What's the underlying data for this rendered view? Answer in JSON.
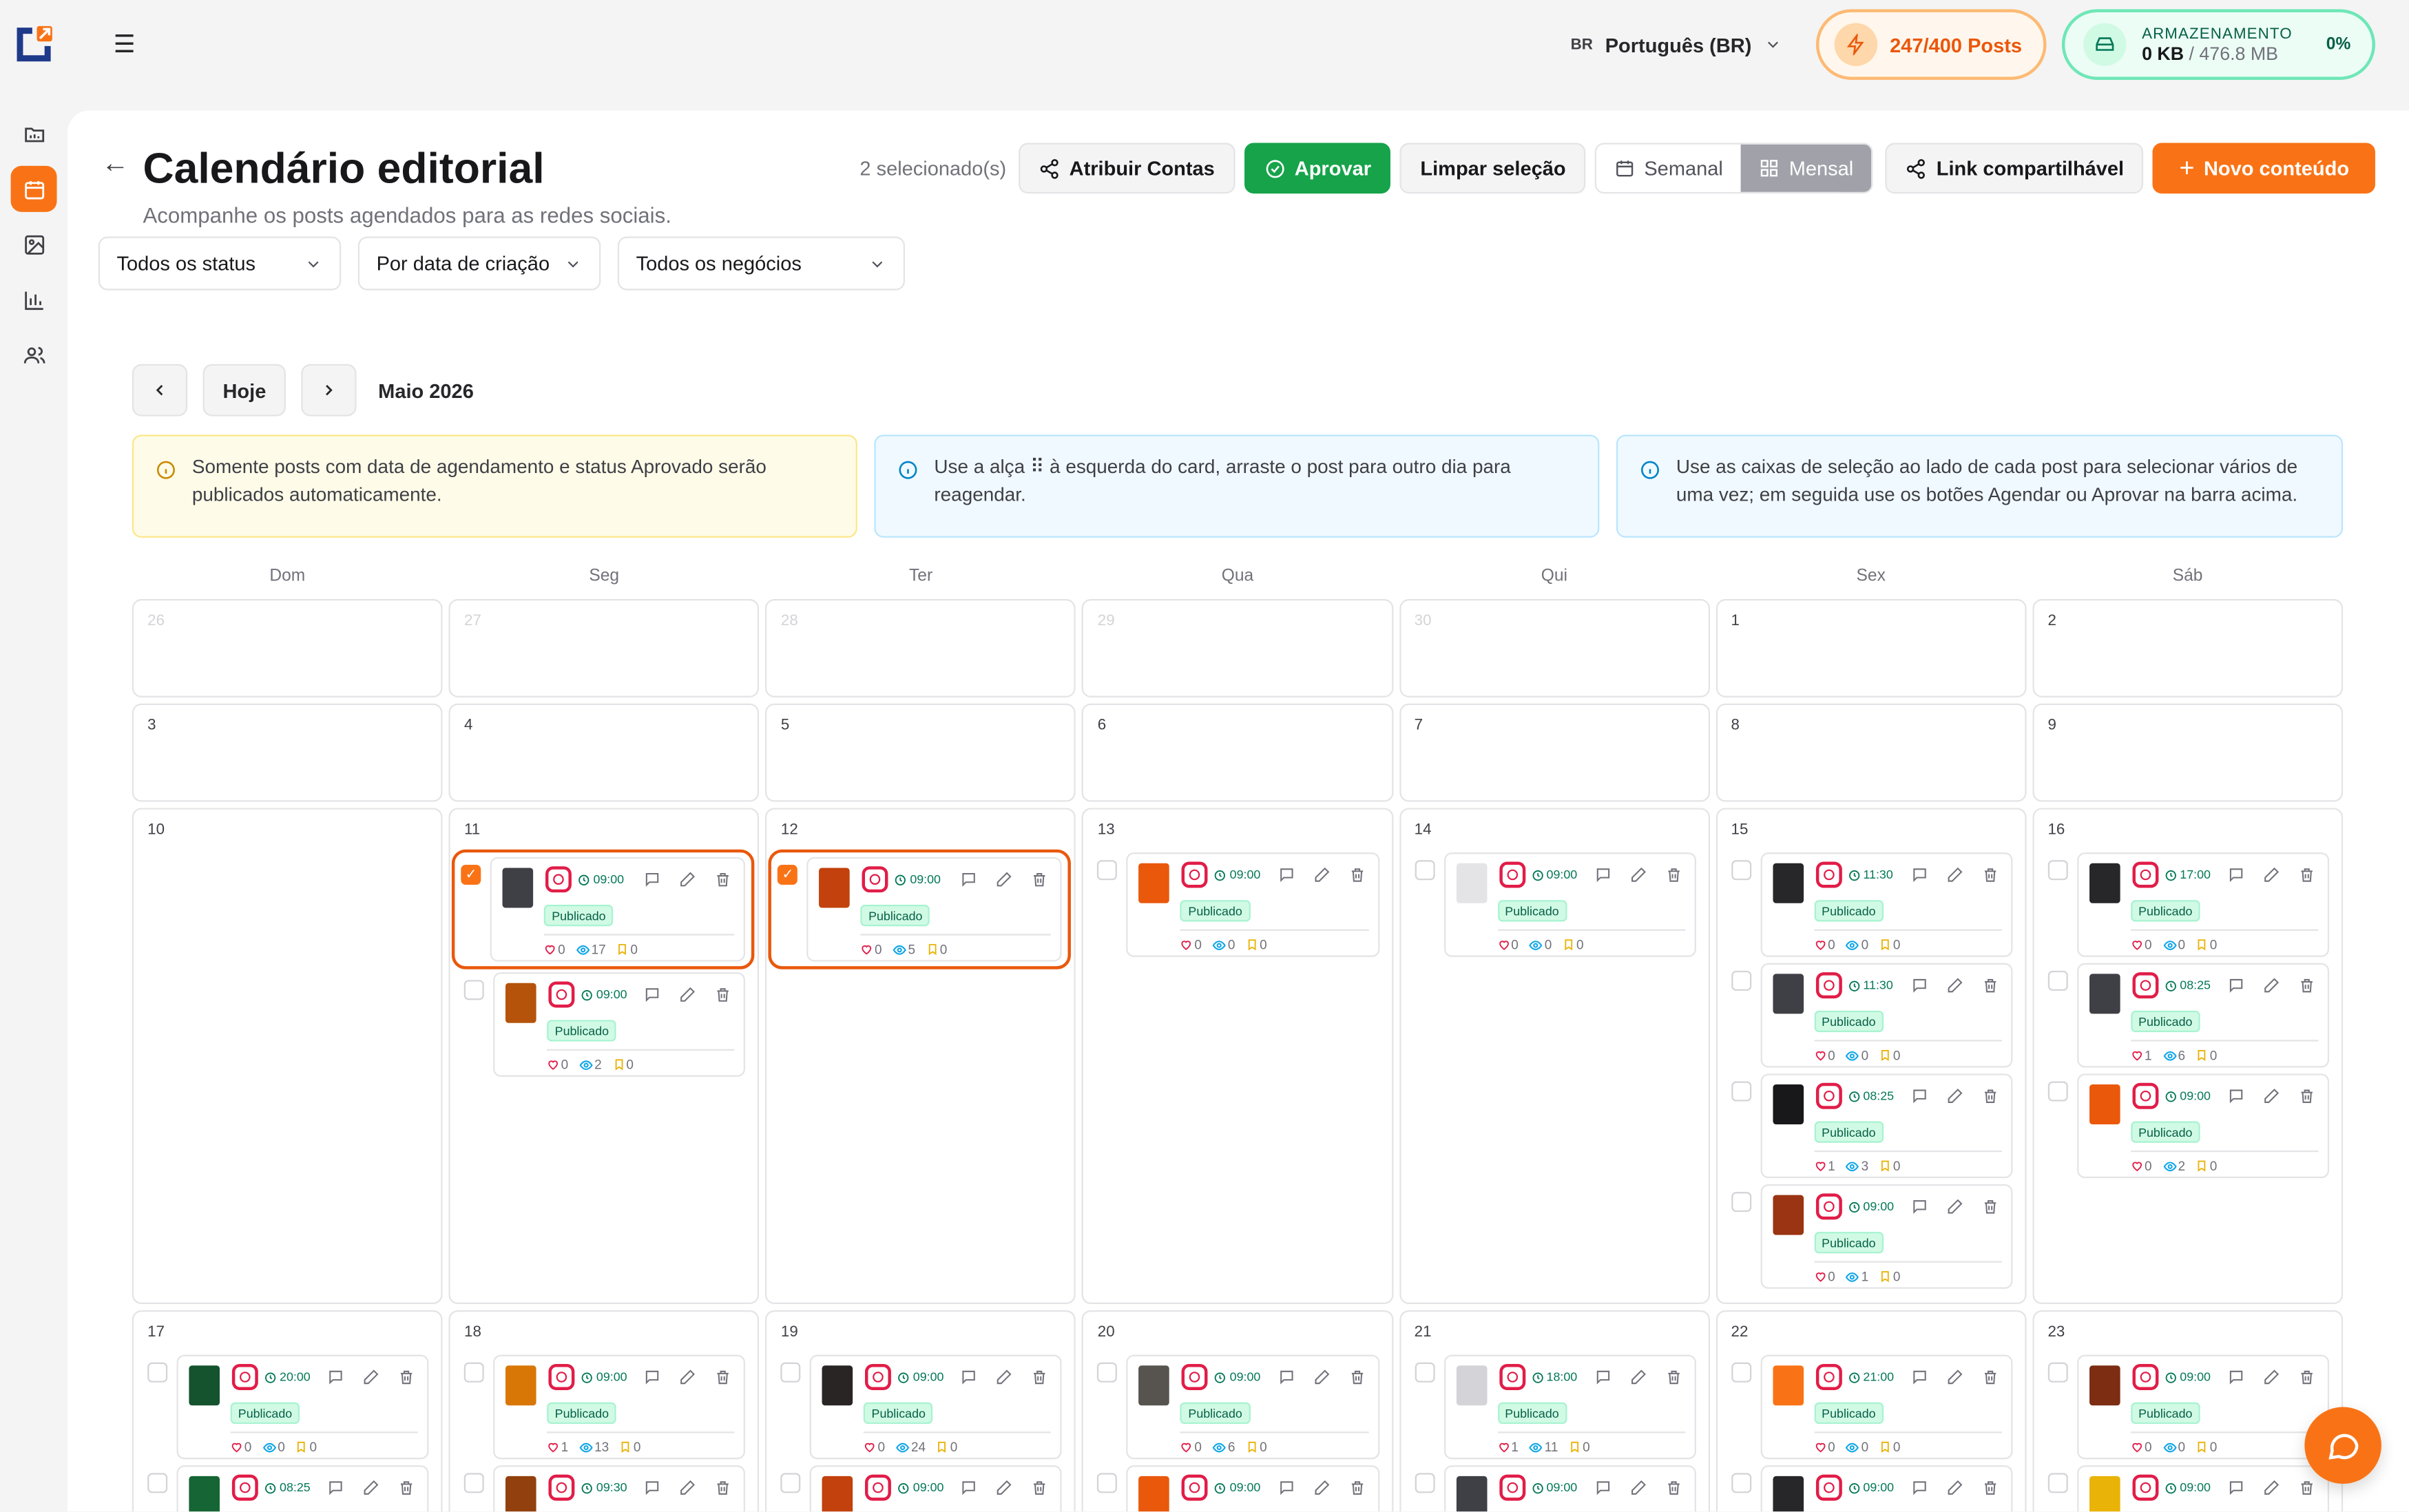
{
  "header": {
    "language_code": "BR",
    "language": "Português (BR)",
    "posts_usage": "247/400 Posts",
    "storage_label": "ARMAZENAMENTO",
    "storage_used": "0 KB",
    "storage_total": "/ 476.8 MB",
    "storage_percent": "0%"
  },
  "page": {
    "title": "Calendário editorial",
    "subtitle": "Acompanhe os posts agendados para as redes sociais.",
    "selected_count": "2 selecionado(s)",
    "assign_label": "Atribuir Contas",
    "approve_label": "Aprovar",
    "clear_label": "Limpar seleção",
    "weekly_label": "Semanal",
    "monthly_label": "Mensal",
    "share_label": "Link compartilhável",
    "new_label": "Novo conteúdo"
  },
  "filters": {
    "status": "Todos os status",
    "date": "Por data de criação",
    "business": "Todos os negócios"
  },
  "nav": {
    "today_label": "Hoje",
    "month": "Maio 2026"
  },
  "banners": {
    "warning": "Somente posts com data de agendamento e status Aprovado serão publicados automaticamente.",
    "drag": "Use a alça ⠿ à esquerda do card, arraste o post para outro dia para reagendar.",
    "select": "Use as caixas de seleção ao lado de cada post para selecionar vários de uma vez; em seguida use os botões Agendar ou Aprovar na barra acima."
  },
  "calendar": {
    "days_of_week": [
      "Dom",
      "Seg",
      "Ter",
      "Qua",
      "Qui",
      "Sex",
      "Sáb"
    ],
    "status_label": "Publicado",
    "weeks": [
      [
        {
          "day": "26",
          "out": true,
          "posts": []
        },
        {
          "day": "27",
          "out": true,
          "posts": []
        },
        {
          "day": "28",
          "out": true,
          "posts": []
        },
        {
          "day": "29",
          "out": true,
          "posts": []
        },
        {
          "day": "30",
          "out": true,
          "posts": []
        },
        {
          "day": "1",
          "out": false,
          "posts": []
        },
        {
          "day": "2",
          "out": false,
          "posts": []
        }
      ],
      [
        {
          "day": "3",
          "out": false,
          "posts": []
        },
        {
          "day": "4",
          "out": false,
          "posts": []
        },
        {
          "day": "5",
          "out": false,
          "posts": []
        },
        {
          "day": "6",
          "out": false,
          "posts": []
        },
        {
          "day": "7",
          "out": false,
          "posts": []
        },
        {
          "day": "8",
          "out": false,
          "posts": []
        },
        {
          "day": "9",
          "out": false,
          "posts": []
        }
      ],
      [
        {
          "day": "10",
          "out": false,
          "posts": []
        },
        {
          "day": "11",
          "out": false,
          "posts": [
            {
              "time": "09:00",
              "likes": "0",
              "views": "17",
              "saves": "0",
              "selected": true,
              "thumb": "#3f3f46"
            },
            {
              "time": "09:00",
              "likes": "0",
              "views": "2",
              "saves": "0",
              "selected": false,
              "thumb": "#b45309"
            }
          ]
        },
        {
          "day": "12",
          "out": false,
          "posts": [
            {
              "time": "09:00",
              "likes": "0",
              "views": "5",
              "saves": "0",
              "selected": true,
              "thumb": "#c2410c"
            }
          ]
        },
        {
          "day": "13",
          "out": false,
          "posts": [
            {
              "time": "09:00",
              "likes": "0",
              "views": "0",
              "saves": "0",
              "selected": false,
              "thumb": "#ea580c"
            }
          ]
        },
        {
          "day": "14",
          "out": false,
          "posts": [
            {
              "time": "09:00",
              "likes": "0",
              "views": "0",
              "saves": "0",
              "selected": false,
              "thumb": "#e4e4e7"
            }
          ]
        },
        {
          "day": "15",
          "out": false,
          "posts": [
            {
              "time": "11:30",
              "likes": "0",
              "views": "0",
              "saves": "0",
              "selected": false,
              "thumb": "#27272a"
            },
            {
              "time": "11:30",
              "likes": "0",
              "views": "0",
              "saves": "0",
              "selected": false,
              "thumb": "#3f3f46"
            },
            {
              "time": "08:25",
              "likes": "1",
              "views": "3",
              "saves": "0",
              "selected": false,
              "thumb": "#18181b"
            },
            {
              "time": "09:00",
              "likes": "0",
              "views": "1",
              "saves": "0",
              "selected": false,
              "thumb": "#9a3412"
            }
          ]
        },
        {
          "day": "16",
          "out": false,
          "posts": [
            {
              "time": "17:00",
              "likes": "0",
              "views": "0",
              "saves": "0",
              "selected": false,
              "thumb": "#27272a"
            },
            {
              "time": "08:25",
              "likes": "1",
              "views": "6",
              "saves": "0",
              "selected": false,
              "thumb": "#3f3f46"
            },
            {
              "time": "09:00",
              "likes": "0",
              "views": "2",
              "saves": "0",
              "selected": false,
              "thumb": "#ea580c"
            }
          ]
        }
      ],
      [
        {
          "day": "17",
          "out": false,
          "posts": [
            {
              "time": "20:00",
              "likes": "0",
              "views": "0",
              "saves": "0",
              "selected": false,
              "thumb": "#14532d"
            },
            {
              "time": "08:25",
              "likes": "",
              "views": "",
              "saves": "",
              "selected": false,
              "thumb": "#166534"
            }
          ]
        },
        {
          "day": "18",
          "out": false,
          "posts": [
            {
              "time": "09:00",
              "likes": "1",
              "views": "13",
              "saves": "0",
              "selected": false,
              "thumb": "#d97706"
            },
            {
              "time": "09:30",
              "likes": "",
              "views": "",
              "saves": "",
              "selected": false,
              "thumb": "#92400e"
            }
          ]
        },
        {
          "day": "19",
          "out": false,
          "posts": [
            {
              "time": "09:00",
              "likes": "0",
              "views": "24",
              "saves": "0",
              "selected": false,
              "thumb": "#292524"
            },
            {
              "time": "09:00",
              "likes": "",
              "views": "",
              "saves": "",
              "selected": false,
              "thumb": "#c2410c"
            }
          ]
        },
        {
          "day": "20",
          "out": false,
          "posts": [
            {
              "time": "09:00",
              "likes": "0",
              "views": "6",
              "saves": "0",
              "selected": false,
              "thumb": "#57534e"
            },
            {
              "time": "09:00",
              "likes": "",
              "views": "",
              "saves": "",
              "selected": false,
              "thumb": "#ea580c"
            }
          ]
        },
        {
          "day": "21",
          "out": false,
          "posts": [
            {
              "time": "18:00",
              "likes": "1",
              "views": "11",
              "saves": "0",
              "selected": false,
              "thumb": "#d4d4d8"
            },
            {
              "time": "09:00",
              "likes": "",
              "views": "",
              "saves": "",
              "selected": false,
              "thumb": "#3f3f46"
            }
          ]
        },
        {
          "day": "22",
          "out": false,
          "posts": [
            {
              "time": "21:00",
              "likes": "0",
              "views": "0",
              "saves": "0",
              "selected": false,
              "thumb": "#f97316"
            },
            {
              "time": "09:00",
              "likes": "",
              "views": "",
              "saves": "",
              "selected": false,
              "thumb": "#27272a"
            }
          ]
        },
        {
          "day": "23",
          "out": false,
          "posts": [
            {
              "time": "09:00",
              "likes": "0",
              "views": "0",
              "saves": "0",
              "selected": false,
              "thumb": "#7c2d12"
            },
            {
              "time": "09:00",
              "likes": "",
              "views": "",
              "saves": "",
              "selected": false,
              "thumb": "#eab308"
            }
          ]
        }
      ]
    ]
  },
  "colors": {
    "accent": "#f97316",
    "approve": "#16a34a",
    "published": "#d1fae5",
    "instagram": "#e11d48"
  }
}
